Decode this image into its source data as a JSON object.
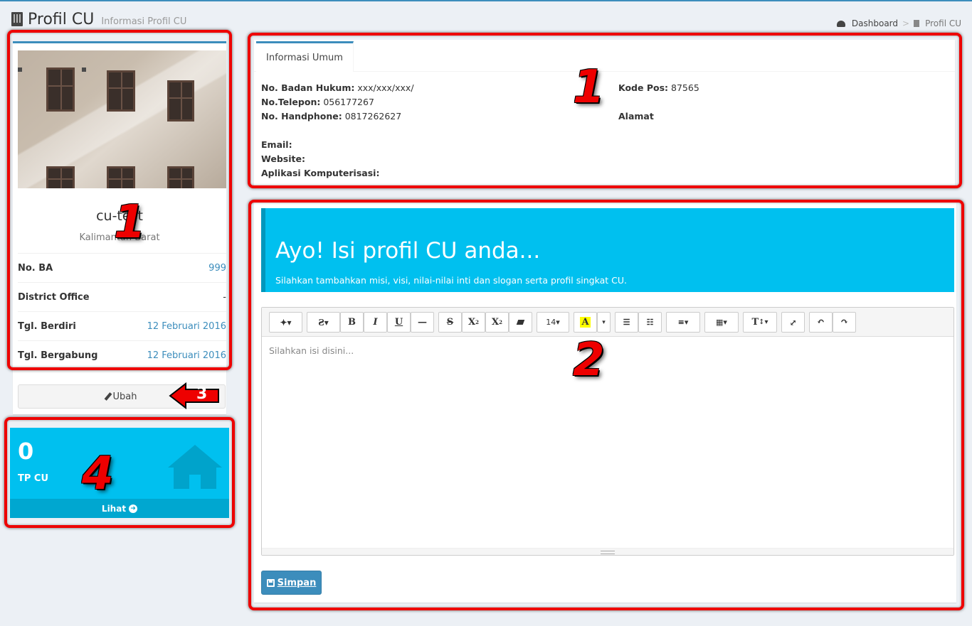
{
  "header": {
    "title": "Profil CU",
    "subtitle": "Informasi Profil CU"
  },
  "breadcrumb": {
    "home": "Dashboard",
    "current": "Profil CU"
  },
  "profile": {
    "name": "cu-test",
    "location": "Kalimantan Barat",
    "rows": [
      {
        "label": "No. BA",
        "value": "999"
      },
      {
        "label": "District Office",
        "value": "-"
      },
      {
        "label": "Tgl. Berdiri",
        "value": "12 Februari 2016"
      },
      {
        "label": "Tgl. Bergabung",
        "value": "12 Februari 2016"
      }
    ],
    "edit_button": "Ubah"
  },
  "stat_box": {
    "value": "0",
    "label": "TP CU",
    "link": "Lihat"
  },
  "info_panel": {
    "tab": "Informasi Umum",
    "left": [
      {
        "label": "No. Badan Hukum:",
        "value": "xxx/xxx/xxx/"
      },
      {
        "label": "No.Telepon:",
        "value": "056177267"
      },
      {
        "label": "No. Handphone:",
        "value": "0817262627"
      },
      {
        "label": "Email:",
        "value": ""
      },
      {
        "label": "Website:",
        "value": ""
      },
      {
        "label": "Aplikasi Komputerisasi:",
        "value": ""
      }
    ],
    "right": [
      {
        "label": "Kode Pos:",
        "value": "87565"
      },
      {
        "label": "Alamat",
        "value": ""
      }
    ]
  },
  "callout": {
    "title": "Ayo! Isi profil CU anda...",
    "text": "Silahkan tambahkan misi, visi, nilai-nilai inti dan slogan serta profil singkat CU."
  },
  "editor": {
    "placeholder": "Silahkan isi disini...",
    "font_size": "14",
    "bold": "B",
    "italic": "I",
    "underline": "U",
    "strike": "S",
    "superscript": "X",
    "subscript": "X",
    "highlight": "A",
    "text_height": "T"
  },
  "save_button": "Simpan",
  "annotations": [
    "1",
    "1",
    "2",
    "3",
    "4"
  ],
  "colors": {
    "primary": "#3c8dbc",
    "info": "#00c0ef",
    "annotation": "#e00000"
  }
}
